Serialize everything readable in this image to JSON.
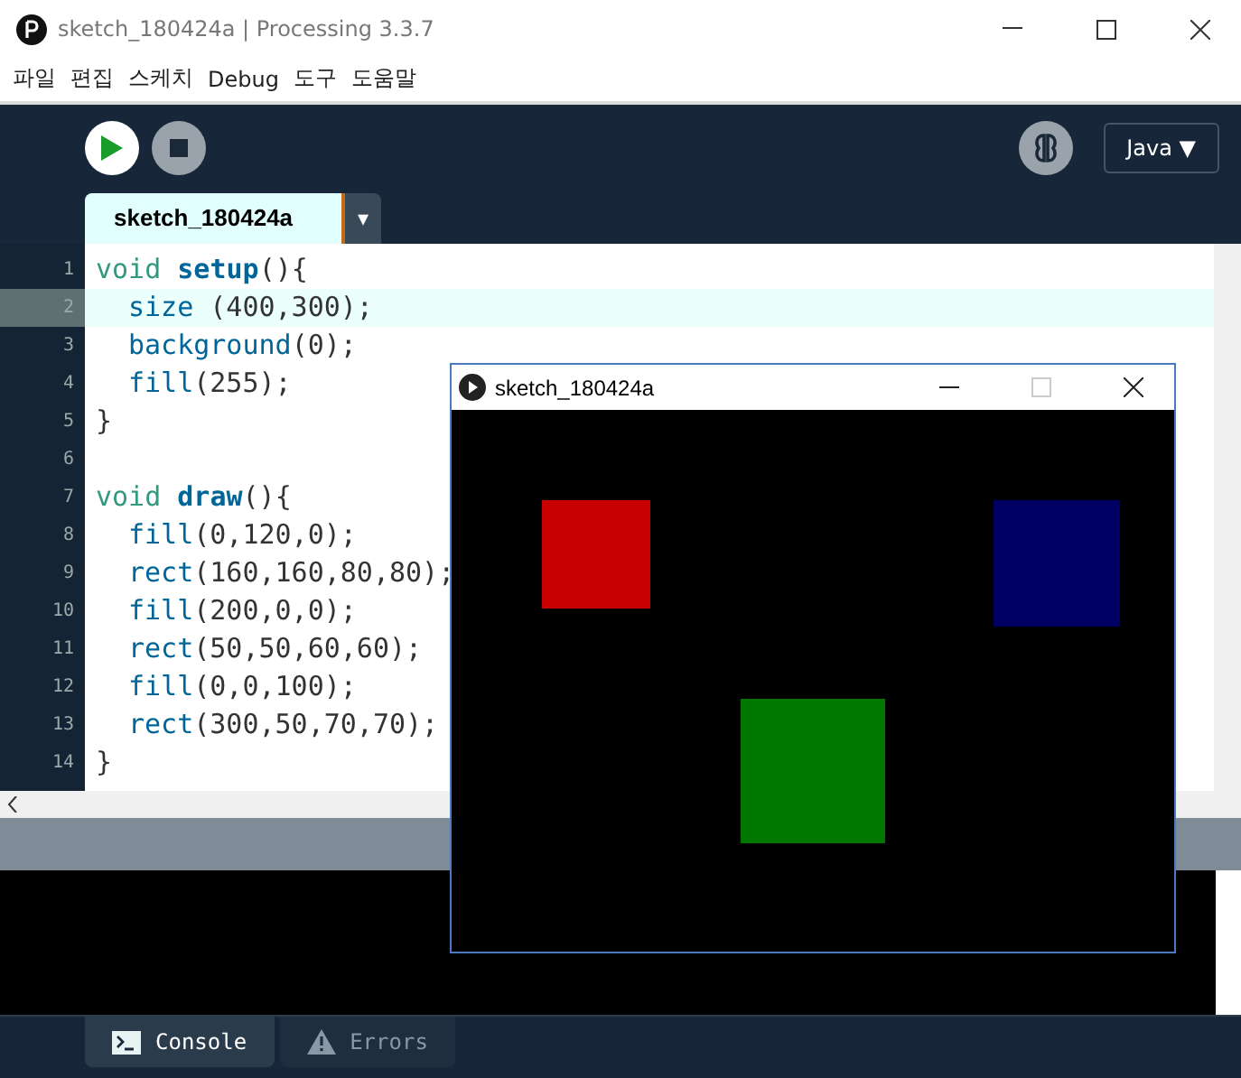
{
  "window": {
    "title": "sketch_180424a | Processing 3.3.7"
  },
  "menu": [
    "파일",
    "편집",
    "스케치",
    "Debug",
    "도구",
    "도움말"
  ],
  "mode": {
    "label": "Java ▼"
  },
  "tabs": [
    {
      "label": "sketch_180424a",
      "selected": true
    }
  ],
  "tab_menu": "▾",
  "code": [
    {
      "number": "1",
      "current": false,
      "indent": false,
      "tokens": [
        {
          "kind": "keyword",
          "text": "void "
        },
        {
          "kind": "fn",
          "text": "setup"
        },
        {
          "kind": "plain",
          "text": "(){"
        }
      ]
    },
    {
      "number": "2",
      "current": true,
      "indent": true,
      "tokens": [
        {
          "kind": "builtin",
          "text": "size"
        },
        {
          "kind": "plain",
          "text": " (400,300);"
        }
      ]
    },
    {
      "number": "3",
      "current": false,
      "indent": true,
      "tokens": [
        {
          "kind": "builtin",
          "text": "background"
        },
        {
          "kind": "plain",
          "text": "(0);"
        }
      ]
    },
    {
      "number": "4",
      "current": false,
      "indent": true,
      "tokens": [
        {
          "kind": "builtin",
          "text": "fill"
        },
        {
          "kind": "plain",
          "text": "(255);"
        }
      ]
    },
    {
      "number": "5",
      "current": false,
      "indent": false,
      "tokens": [
        {
          "kind": "plain",
          "text": "}"
        }
      ]
    },
    {
      "number": "6",
      "current": false
    },
    {
      "number": "7",
      "current": false,
      "indent": false,
      "tokens": [
        {
          "kind": "keyword",
          "text": "void "
        },
        {
          "kind": "fn",
          "text": "draw"
        },
        {
          "kind": "plain",
          "text": "(){"
        }
      ]
    },
    {
      "number": "8",
      "current": false,
      "indent": true,
      "tokens": [
        {
          "kind": "builtin",
          "text": "fill"
        },
        {
          "kind": "plain",
          "text": "(0,120,0);"
        }
      ]
    },
    {
      "number": "9",
      "current": false,
      "indent": true,
      "tokens": [
        {
          "kind": "builtin",
          "text": "rect"
        },
        {
          "kind": "plain",
          "text": "(160,160,80,80);"
        }
      ]
    },
    {
      "number": "10",
      "current": false,
      "indent": true,
      "tokens": [
        {
          "kind": "builtin",
          "text": "fill"
        },
        {
          "kind": "plain",
          "text": "(200,0,0);"
        }
      ]
    },
    {
      "number": "11",
      "current": false,
      "indent": true,
      "tokens": [
        {
          "kind": "builtin",
          "text": "rect"
        },
        {
          "kind": "plain",
          "text": "(50,50,60,60);"
        }
      ]
    },
    {
      "number": "12",
      "current": false,
      "indent": true,
      "tokens": [
        {
          "kind": "builtin",
          "text": "fill"
        },
        {
          "kind": "plain",
          "text": "(0,0,100);"
        }
      ]
    },
    {
      "number": "13",
      "current": false,
      "indent": true,
      "tokens": [
        {
          "kind": "builtin",
          "text": "rect"
        },
        {
          "kind": "plain",
          "text": "(300,50,70,70);"
        }
      ]
    },
    {
      "number": "14",
      "current": false,
      "indent": false,
      "tokens": [
        {
          "kind": "plain",
          "text": "}"
        }
      ]
    }
  ],
  "bottom_tabs": [
    {
      "label": "Console",
      "selected": true,
      "kind": "console"
    },
    {
      "label": "Errors",
      "selected": false,
      "kind": "errors"
    }
  ],
  "sketch_window": {
    "title": "sketch_180424a"
  }
}
